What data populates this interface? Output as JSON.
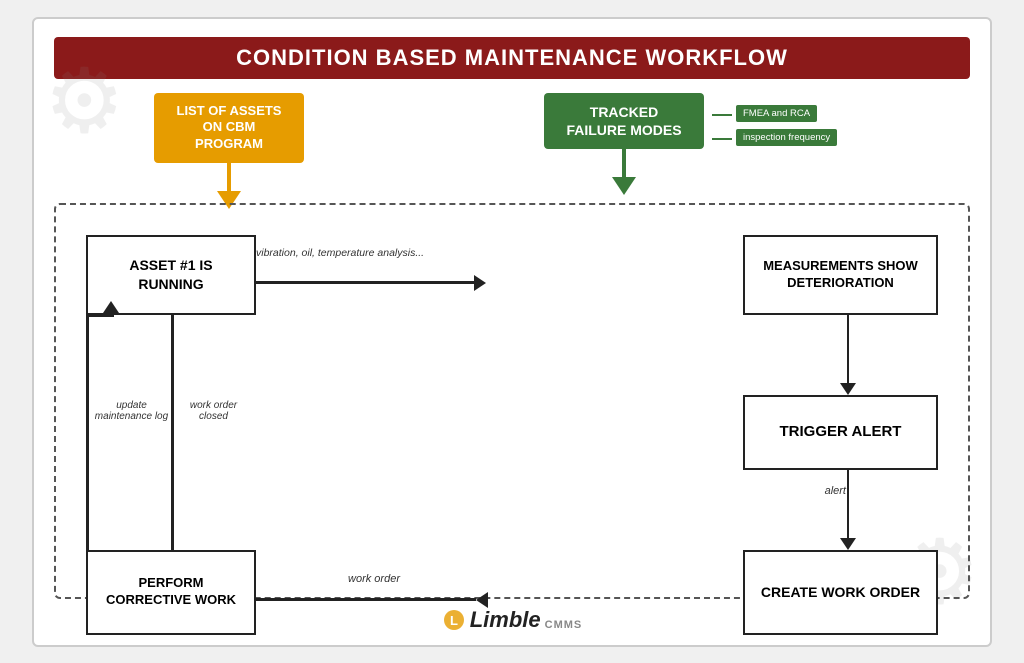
{
  "title": "CONDITION BASED MAINTENANCE WORKFLOW",
  "labels": {
    "assets": "LIST OF ASSETS ON CBM PROGRAM",
    "tracked": "TRACKED FAILURE MODES",
    "fmea1": "FMEA and RCA",
    "fmea2": "inspection frequency"
  },
  "nodes": {
    "asset": "ASSET #1 IS RUNNING",
    "measurements": "MEASUREMENTS SHOW DETERIORATION",
    "trigger": "TRIGGER ALERT",
    "createWO": "CREATE WORK ORDER",
    "perform": "PERFORM CORRECTIVE WORK"
  },
  "annotations": {
    "vibration": "vibration, oil, temperature analysis...",
    "alert": "alert",
    "workOrder": "work order",
    "workOrderClosed": "work order closed",
    "updateLog": "update maintenance log"
  },
  "logo": {
    "limble": "Limble",
    "cmms": "CMMS"
  }
}
